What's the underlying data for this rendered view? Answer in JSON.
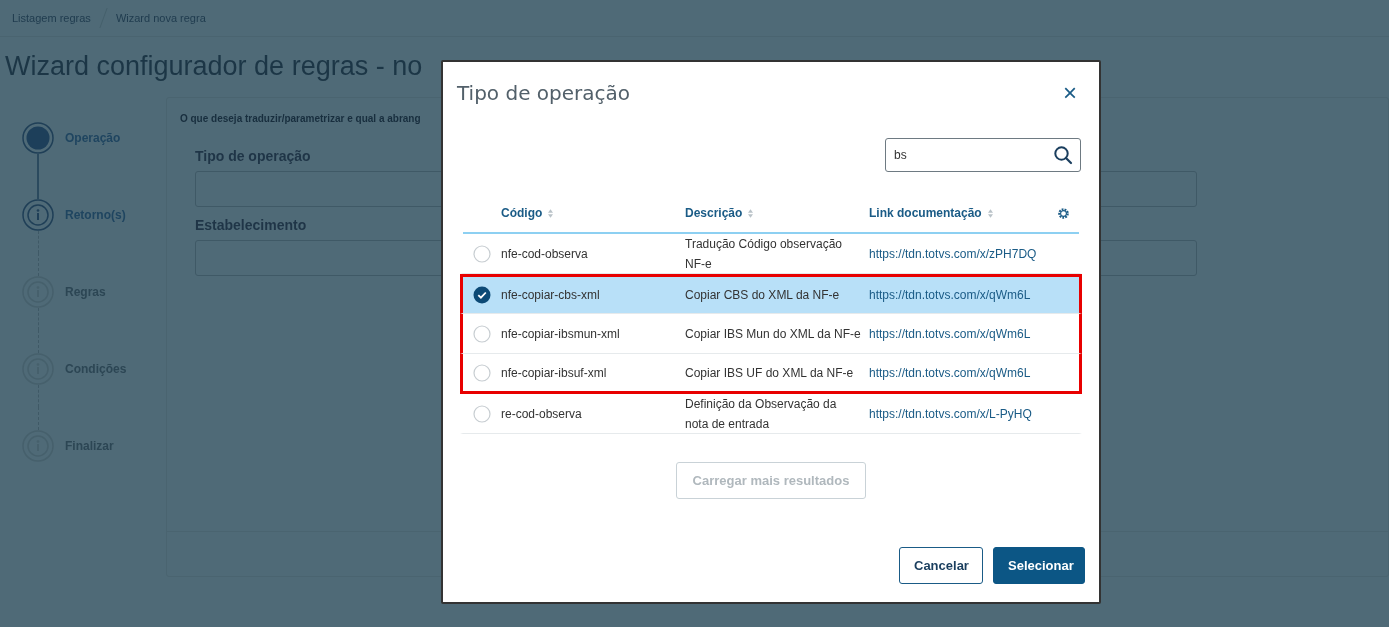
{
  "breadcrumb": [
    "Listagem regras",
    "Wizard nova regra"
  ],
  "page_title": "Wizard configurador de regras - no",
  "steps": [
    {
      "label": "Operação",
      "active": true,
      "disabled": false
    },
    {
      "label": "Retorno(s)",
      "active": false,
      "disabled": false
    },
    {
      "label": "Regras",
      "active": false,
      "disabled": true
    },
    {
      "label": "Condições",
      "active": false,
      "disabled": true
    },
    {
      "label": "Finalizar",
      "active": false,
      "disabled": true
    }
  ],
  "form": {
    "intro": "O que deseja traduzir/parametrizar e qual a abrang",
    "fields": [
      {
        "label": "Tipo de operação"
      },
      {
        "label": "Estabelecimento"
      }
    ]
  },
  "modal": {
    "title": "Tipo de operação",
    "close": "×",
    "search": {
      "value": "bs"
    },
    "table": {
      "columns": [
        "Código",
        "Descrição",
        "Link documentação"
      ],
      "rows": [
        {
          "code": "nfe-cod-observa",
          "description": "Tradução Código observação NF-e",
          "link": "https://tdn.totvs.com/x/zPH7DQ",
          "selected": false,
          "highlighted": false
        },
        {
          "code": "nfe-copiar-cbs-xml",
          "description": "Copiar CBS do XML da NF-e",
          "link": "https://tdn.totvs.com/x/qWm6L",
          "selected": true,
          "highlighted": true
        },
        {
          "code": "nfe-copiar-ibsmun-xml",
          "description": "Copiar IBS Mun do XML da NF-e",
          "link": "https://tdn.totvs.com/x/qWm6L",
          "selected": false,
          "highlighted": true
        },
        {
          "code": "nfe-copiar-ibsuf-xml",
          "description": "Copiar IBS UF do XML da NF-e",
          "link": "https://tdn.totvs.com/x/qWm6L",
          "selected": false,
          "highlighted": true
        },
        {
          "code": "re-cod-observa",
          "description": "Definição da Observação da nota de entrada",
          "link": "https://tdn.totvs.com/x/L-PyHQ",
          "selected": false,
          "highlighted": false
        }
      ]
    },
    "load_more": {
      "label": "Carregar mais resultados",
      "disabled": true
    },
    "buttons": [
      {
        "label": "Cancelar",
        "kind": "secondary"
      },
      {
        "label": "Selecionar",
        "kind": "primary"
      }
    ]
  }
}
